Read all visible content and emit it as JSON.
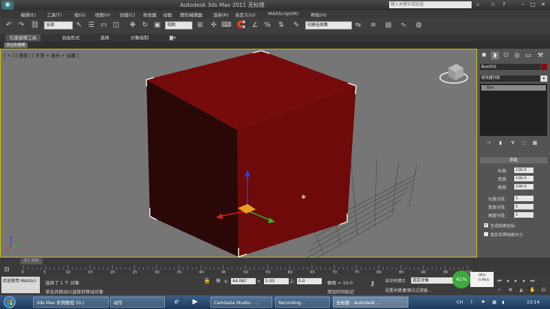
{
  "app": {
    "title": "Autodesk 3ds Max 2011   无标题",
    "search_placeholder": "键入关键字或短语",
    "logo_icon": "app-logo-icon"
  },
  "menu": [
    "编辑(E)",
    "工具(T)",
    "组(G)",
    "视图(V)",
    "创建(C)",
    "修改器",
    "动画",
    "图形编辑器",
    "渲染(R)",
    "自定义(U)",
    "MAXScript(M)",
    "帮助(H)"
  ],
  "toolbar": {
    "select_filter": "全部",
    "view_mode": "视图",
    "named_selection": "创建选择集"
  },
  "ribbon": {
    "tabs": [
      "石墨建模工具",
      "自由形式",
      "选择",
      "对象绘制"
    ],
    "panel_label": "多边形建模"
  },
  "viewport": {
    "label": "[ + ] [ 透视 ] [ 平滑 + 高光 + 边面 ]",
    "object_color": "#6e0a0a",
    "border_color": "#d4c600"
  },
  "command_panel": {
    "object_name": "Box001",
    "object_color": "#8a0a0a",
    "modifier_list": "修改器列表",
    "stack_item": "Box",
    "params_header": "参数",
    "params": [
      {
        "label": "长度:",
        "value": "100.0"
      },
      {
        "label": "宽度:",
        "value": "100.0"
      },
      {
        "label": "高度:",
        "value": "100.0"
      }
    ],
    "segments": [
      {
        "label": "长度分段:",
        "value": "1"
      },
      {
        "label": "宽度分段:",
        "value": "1"
      },
      {
        "label": "高度分段:",
        "value": "1"
      }
    ],
    "checkboxes": [
      {
        "label": "生成贴图坐标",
        "checked": "✓"
      },
      {
        "label": "真实世界贴图大小",
        "checked": ""
      }
    ]
  },
  "timeline": {
    "slider": "0 / 100",
    "ticks": [
      "0",
      "5",
      "10",
      "15",
      "20",
      "25",
      "30",
      "35",
      "40",
      "45",
      "50",
      "55",
      "60",
      "65",
      "70",
      "75",
      "80",
      "85",
      "90",
      "95",
      "100"
    ]
  },
  "status": {
    "maxscript_label": "欢迎使用 MAXScr",
    "line1": "选择了 1 个 对象",
    "line2": "单击并拖动以选择并移动对象",
    "x_label": "X:",
    "x_val": "44.087",
    "y_label": "Y:",
    "y_val": "5.03",
    "z_label": "Z:",
    "z_val": "0.0",
    "grid": "栅格 = 10.0",
    "add_time": "添加时间标记",
    "auto_key": "自动关键点",
    "set_key": "设置关键点",
    "key_field": "选定对象",
    "key_filter": "关键点过滤器...",
    "perf_percent": "41%",
    "perf_up": "0K/s",
    "perf_down": "0.4K/s"
  },
  "taskbar": {
    "buttons": [
      "3ds Max 实例教程 (G:)",
      "动作",
      "Camtasia Studio - ...",
      "Recording...",
      "无标题 - Autodesk ..."
    ],
    "lang": "CH",
    "clock": "13:14"
  }
}
